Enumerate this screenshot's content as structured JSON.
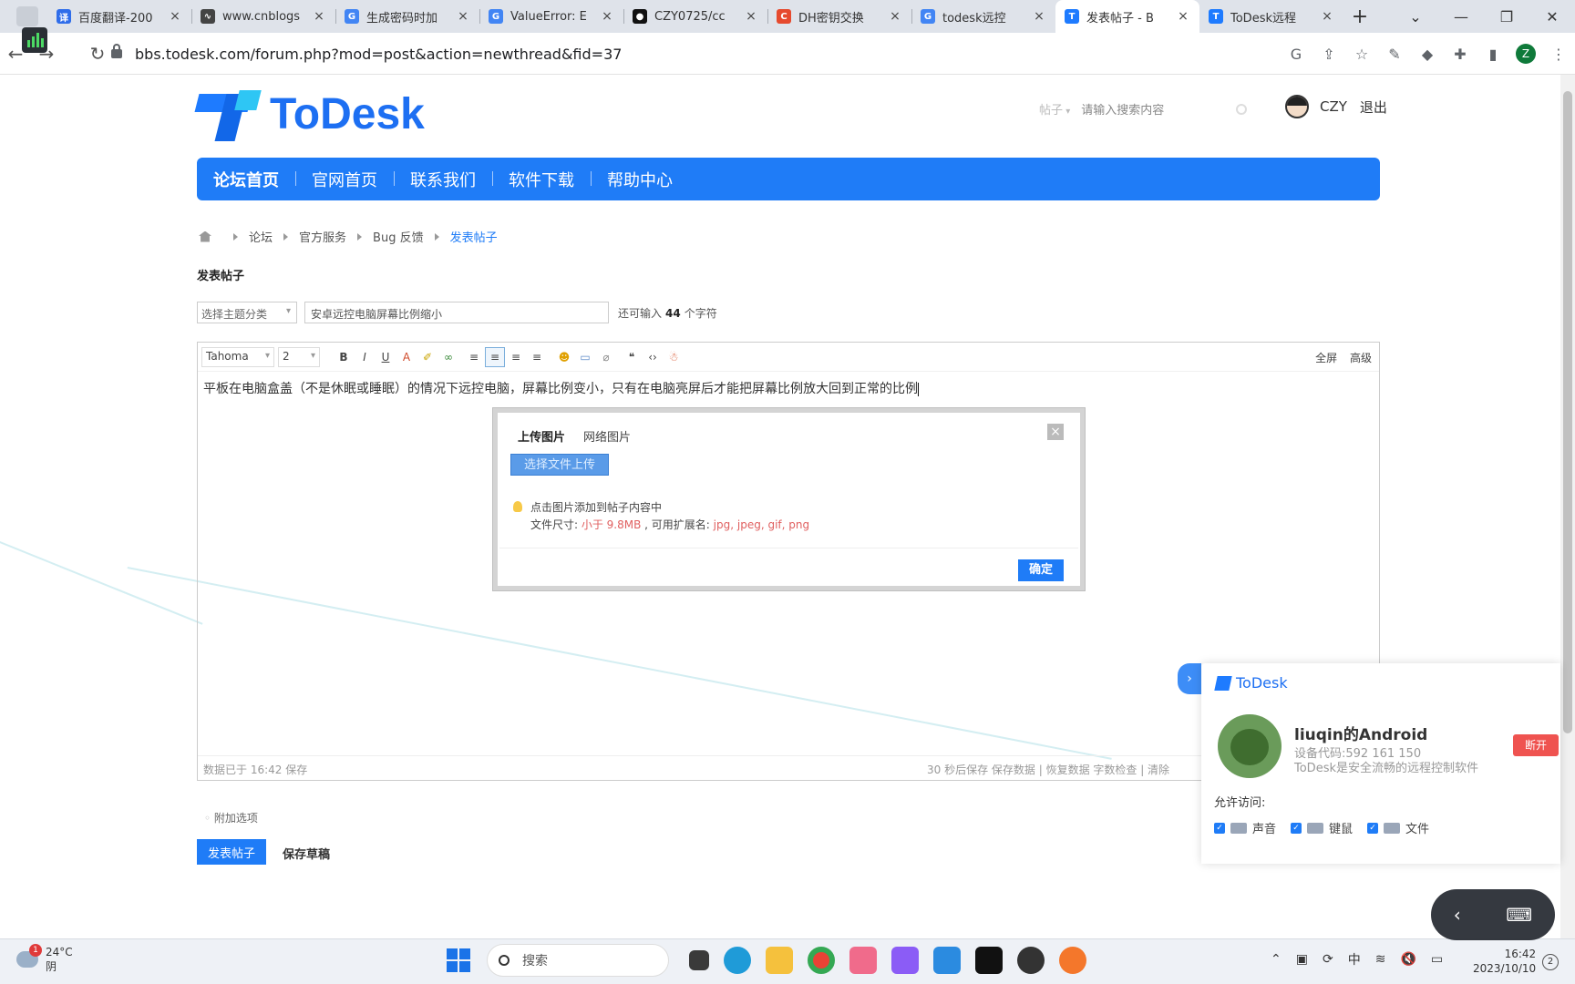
{
  "browser": {
    "tabs": [
      {
        "title": "百度翻译-200",
        "icon": "baidu-translate-icon",
        "color": "#2f6dea",
        "glyph": "译"
      },
      {
        "title": "www.cnblogs",
        "icon": "cnblogs-icon",
        "color": "#444444",
        "glyph": "∿"
      },
      {
        "title": "生成密码时加",
        "icon": "google-icon",
        "color": "#4285f4",
        "glyph": "G"
      },
      {
        "title": "ValueError: E",
        "icon": "google-icon",
        "color": "#4285f4",
        "glyph": "G"
      },
      {
        "title": "CZY0725/cc",
        "icon": "github-icon",
        "color": "#111111",
        "glyph": "●"
      },
      {
        "title": "DH密钥交换",
        "icon": "csdn-icon",
        "color": "#e64a2e",
        "glyph": "C"
      },
      {
        "title": "todesk远控",
        "icon": "google-icon",
        "color": "#4285f4",
        "glyph": "G"
      },
      {
        "title": "发表帖子 - B",
        "icon": "todesk-icon",
        "color": "#1e7bff",
        "glyph": "T",
        "active": true
      },
      {
        "title": "ToDesk远程",
        "icon": "todesk-icon",
        "color": "#1e7bff",
        "glyph": "T"
      }
    ],
    "new_tab": "+",
    "url": "bbs.todesk.com/forum.php?mod=post&action=newthread&fid=37",
    "profile_letter": "Z"
  },
  "site": {
    "logo_text": "ToDesk",
    "search_type": "帖子",
    "search_placeholder": "请输入搜索内容",
    "username": "CZY",
    "logout": "退出",
    "nav": [
      "论坛首页",
      "官网首页",
      "联系我们",
      "软件下载",
      "帮助中心"
    ],
    "breadcrumbs": [
      "论坛",
      "官方服务",
      "Bug 反馈",
      "发表帖子"
    ]
  },
  "post": {
    "heading": "发表帖子",
    "category_placeholder": "选择主题分类",
    "subject": "安卓远控电脑屏幕比例缩小",
    "char_remaining_prefix": "还可输入",
    "char_remaining": "44",
    "char_remaining_suffix": "个字符",
    "font_family": "Tahoma",
    "font_size": "2",
    "toolbar_right": [
      "全屏",
      "高级"
    ],
    "body": "平板在电脑盒盖（不是休眠或睡眠）的情况下远控电脑，屏幕比例变小，只有在电脑亮屏后才能把屏幕比例放大回到正常的比例",
    "saved_status": "数据已于 16:42 保存",
    "status_right": "30 秒后保存 保存数据 | 恢复数据    字数检查 | 清除",
    "attach_options": "附加选项",
    "submit": "发表帖子",
    "save_draft": "保存草稿"
  },
  "dialog": {
    "tabs": [
      "上传图片",
      "网络图片"
    ],
    "upload_button": "选择文件上传",
    "tip_line1": "点击图片添加到帖子内容中",
    "tip_size_label": "文件尺寸: ",
    "tip_size_value": "小于 9.8MB",
    "tip_ext_label": " , 可用扩展名: ",
    "tip_ext_value": "jpg, jpeg, gif, png",
    "ok": "确定",
    "close": "×"
  },
  "todesk_panel": {
    "brand": "ToDesk",
    "device_name": "liuqin的Android",
    "device_code": "设备代码:592 161 150",
    "description": "ToDesk是安全流畅的远程控制软件",
    "disconnect": "断开",
    "allow_label": "允许访问:",
    "permissions": [
      "声音",
      "键鼠",
      "文件"
    ]
  },
  "taskbar": {
    "temperature": "24°C",
    "weather": "阴",
    "weather_badge": "1",
    "search_placeholder": "搜索",
    "ime": "中",
    "time": "16:42",
    "date": "2023/10/10",
    "notifications": "2"
  }
}
